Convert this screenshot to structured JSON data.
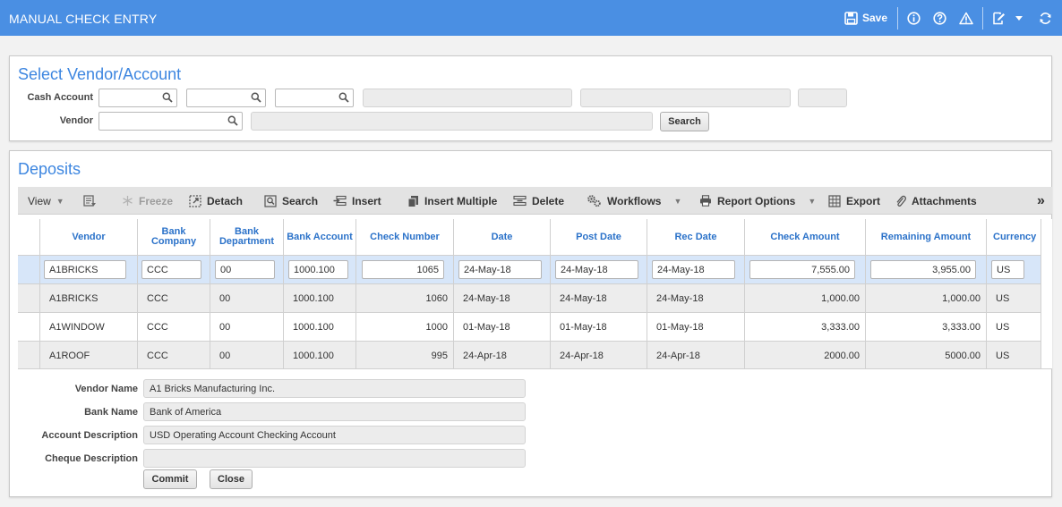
{
  "window": {
    "title": "MANUAL CHECK ENTRY",
    "save_label": "Save"
  },
  "select_panel": {
    "title": "Select Vendor/Account",
    "cash_account_label": "Cash Account",
    "vendor_label": "Vendor",
    "search_button": "Search"
  },
  "deposits": {
    "title": "Deposits",
    "toolbar": {
      "view": "View",
      "freeze": "Freeze",
      "detach": "Detach",
      "search": "Search",
      "insert": "Insert",
      "insert_multiple": "Insert Multiple",
      "delete": "Delete",
      "workflows": "Workflows",
      "report_options": "Report Options",
      "export": "Export",
      "attachments": "Attachments",
      "more": "»"
    },
    "columns": {
      "vendor": "Vendor",
      "bank_company": "Bank Company",
      "bank_department": "Bank Department",
      "bank_account": "Bank Account",
      "check_number": "Check Number",
      "date": "Date",
      "post_date": "Post Date",
      "rec_date": "Rec Date",
      "check_amount": "Check Amount",
      "remaining_amount": "Remaining Amount",
      "currency": "Currency"
    },
    "rows": [
      {
        "vendor": "A1BRICKS",
        "bank_company": "CCC",
        "bank_department": "00",
        "bank_account": "1000.100",
        "check_number": "1065",
        "date": "24-May-18",
        "post_date": "24-May-18",
        "rec_date": "24-May-18",
        "check_amount": "7,555.00",
        "remaining_amount": "3,955.00",
        "currency": "US"
      },
      {
        "vendor": "A1BRICKS",
        "bank_company": "CCC",
        "bank_department": "00",
        "bank_account": "1000.100",
        "check_number": "1060",
        "date": "24-May-18",
        "post_date": "24-May-18",
        "rec_date": "24-May-18",
        "check_amount": "1,000.00",
        "remaining_amount": "1,000.00",
        "currency": "US"
      },
      {
        "vendor": "A1WINDOW",
        "bank_company": "CCC",
        "bank_department": "00",
        "bank_account": "1000.100",
        "check_number": "1000",
        "date": "01-May-18",
        "post_date": "01-May-18",
        "rec_date": "01-May-18",
        "check_amount": "3,333.00",
        "remaining_amount": "3,333.00",
        "currency": "US"
      },
      {
        "vendor": "A1ROOF",
        "bank_company": "CCC",
        "bank_department": "00",
        "bank_account": "1000.100",
        "check_number": "995",
        "date": "24-Apr-18",
        "post_date": "24-Apr-18",
        "rec_date": "24-Apr-18",
        "check_amount": "2000.00",
        "remaining_amount": "5000.00",
        "currency": "US"
      }
    ],
    "details": {
      "vendor_name_label": "Vendor Name",
      "vendor_name": "A1 Bricks Manufacturing Inc.",
      "bank_name_label": "Bank Name",
      "bank_name": "Bank of America",
      "account_description_label": "Account Description",
      "account_description": "USD Operating Account Checking Account",
      "cheque_description_label": "Cheque Description",
      "cheque_description": ""
    },
    "commit_button": "Commit",
    "close_button": "Close"
  },
  "colors": {
    "titlebar": "#4a8fe3",
    "accent": "#3d86e0",
    "selected_row": "#d7e6f9"
  },
  "icons": [
    "save-icon",
    "info-icon",
    "help-icon",
    "warning-icon",
    "edit-icon",
    "chevron-down-icon",
    "refresh-icon",
    "search-icon"
  ]
}
